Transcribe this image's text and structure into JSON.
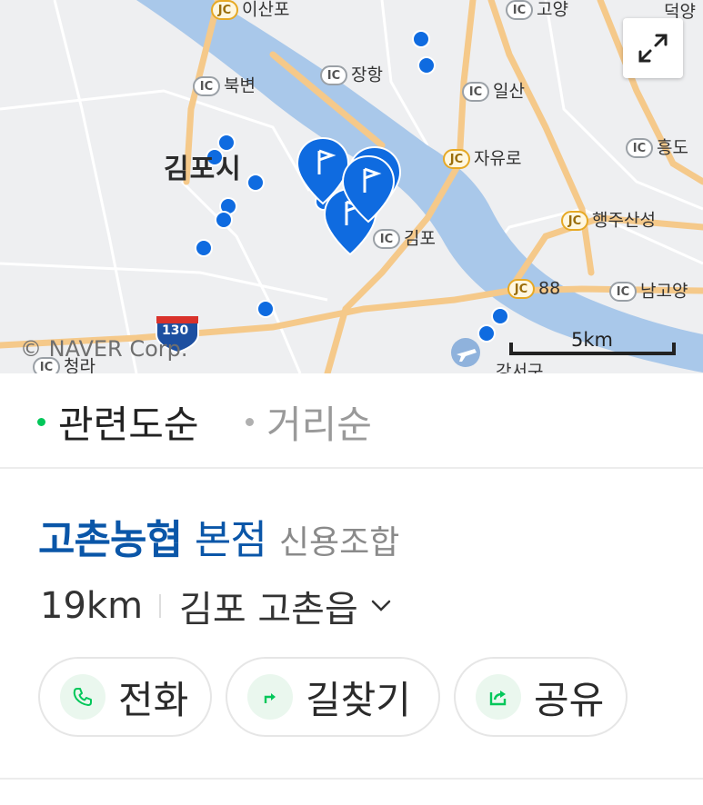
{
  "map": {
    "copyright": "© NAVER Corp.",
    "scale_label": "5km",
    "city": "김포시",
    "highway_number": "130",
    "labels": [
      {
        "badge": "JC",
        "text": "이산포"
      },
      {
        "badge": "IC",
        "text": "고양"
      },
      {
        "badge": "",
        "text": "덕양"
      },
      {
        "badge": "IC",
        "text": "장항"
      },
      {
        "badge": "IC",
        "text": "북변"
      },
      {
        "badge": "IC",
        "text": "일산"
      },
      {
        "badge": "JC",
        "text": "자유로"
      },
      {
        "badge": "IC",
        "text": "흥도"
      },
      {
        "badge": "JC",
        "text": "행주산성"
      },
      {
        "badge": "IC",
        "text": "김포"
      },
      {
        "badge": "JC",
        "text": "88"
      },
      {
        "badge": "IC",
        "text": "남고양"
      },
      {
        "badge": "IC",
        "text": "청라"
      },
      {
        "badge": "",
        "text": "강서구"
      }
    ],
    "colors": {
      "land": "#eeeff1",
      "river": "#a9c8ea",
      "road": "#f5c98a",
      "marker": "#0f6be0"
    }
  },
  "sort": {
    "options": [
      {
        "label": "관련도순",
        "active": true
      },
      {
        "label": "거리순",
        "active": false
      }
    ],
    "active_color": "#03c75a"
  },
  "result": {
    "name": "고촌농협",
    "branch": "본점",
    "category": "신용조합",
    "distance": "19km",
    "address": "김포 고촌읍",
    "buttons": [
      {
        "label": "전화",
        "icon": "phone-icon"
      },
      {
        "label": "길찾기",
        "icon": "directions-icon"
      },
      {
        "label": "공유",
        "icon": "share-icon"
      }
    ]
  }
}
